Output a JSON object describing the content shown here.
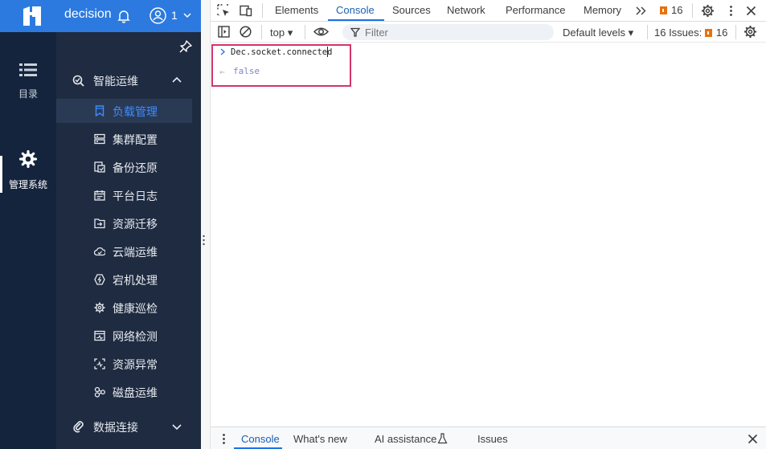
{
  "app": {
    "title": "decision",
    "user_count": "1",
    "rail": [
      {
        "label": "目录",
        "icon": "list-icon"
      },
      {
        "label": "管理系统",
        "icon": "gear-icon"
      }
    ],
    "groups": {
      "ops": "智能运维",
      "data": "数据连接"
    },
    "menu_items": [
      {
        "label": "负载管理",
        "icon": "bookmark-icon",
        "active": true
      },
      {
        "label": "集群配置",
        "icon": "server-icon"
      },
      {
        "label": "备份还原",
        "icon": "backup-icon"
      },
      {
        "label": "平台日志",
        "icon": "calendar-icon"
      },
      {
        "label": "资源迁移",
        "icon": "folder-move-icon"
      },
      {
        "label": "云端运维",
        "icon": "cloud-icon"
      },
      {
        "label": "宕机处理",
        "icon": "power-icon"
      },
      {
        "label": "健康巡检",
        "icon": "gear-check-icon"
      },
      {
        "label": "网络检测",
        "icon": "network-icon"
      },
      {
        "label": "资源异常",
        "icon": "scan-icon"
      },
      {
        "label": "磁盘运维",
        "icon": "disk-icon"
      }
    ]
  },
  "devtools": {
    "tabs": [
      "Elements",
      "Console",
      "Sources",
      "Network",
      "Performance",
      "Memory"
    ],
    "active_tab": "Console",
    "issues_badge": "16",
    "toolbar": {
      "context": "top",
      "filter_placeholder": "Filter",
      "levels": "Default levels",
      "issues_label": "16 Issues:",
      "issues_count": "16"
    },
    "console": {
      "command": "Dec.socket.connected",
      "result": "false"
    },
    "drawer_tabs": [
      "Console",
      "What's new",
      "AI assistance",
      "Issues"
    ],
    "colors": {
      "header_blue": "#2c7ae0",
      "menu_bg": "#1f2b40",
      "rail_bg": "#15243d",
      "active_text": "#3b8cff",
      "highlight_border": "#d6336c",
      "issue_orange": "#e8710a"
    }
  }
}
